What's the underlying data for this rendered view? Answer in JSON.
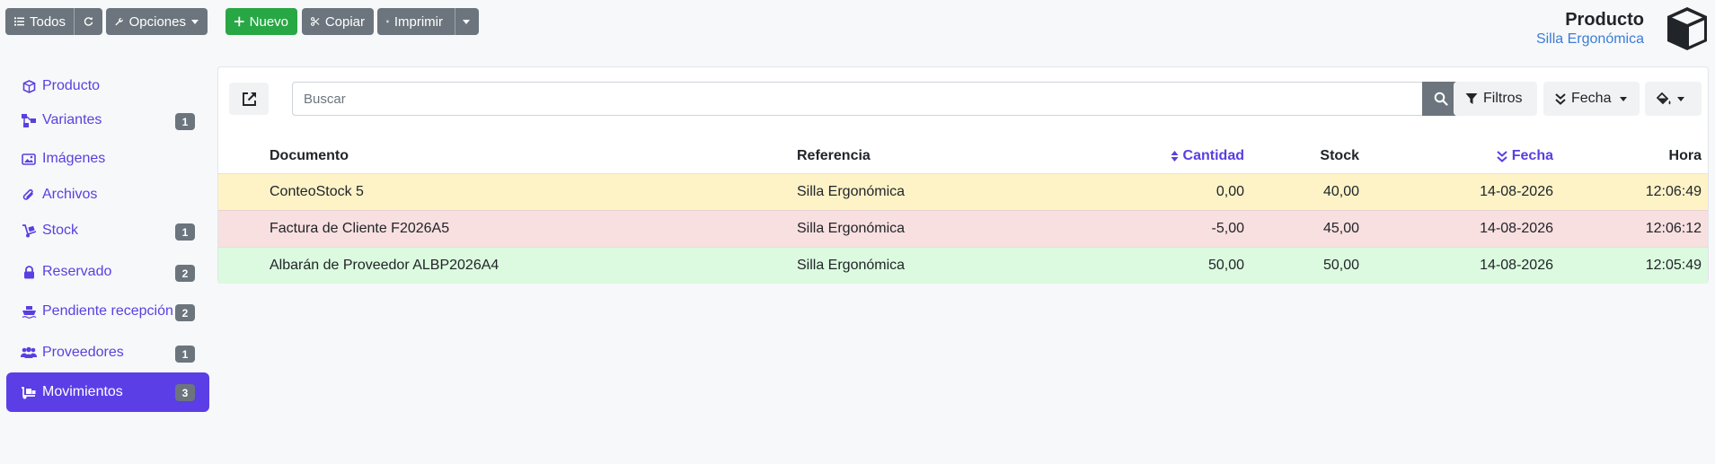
{
  "toolbar": {
    "todos_label": "Todos",
    "opciones_label": "Opciones",
    "nuevo_label": "Nuevo",
    "copiar_label": "Copiar",
    "imprimir_label": "Imprimir"
  },
  "header": {
    "title": "Producto",
    "subtitle": "Silla Ergonómica"
  },
  "sidebar": {
    "items": [
      {
        "label": "Producto",
        "icon": "cube-icon",
        "badge": null
      },
      {
        "label": "Variantes",
        "icon": "sitemap-icon",
        "badge": "1"
      },
      {
        "label": "Imágenes",
        "icon": "images-icon",
        "badge": null
      },
      {
        "label": "Archivos",
        "icon": "paperclip-icon",
        "badge": null
      },
      {
        "label": "Stock",
        "icon": "dolly-icon",
        "badge": "1"
      },
      {
        "label": "Reservado",
        "icon": "lock-icon",
        "badge": "2"
      },
      {
        "label": "Pendiente recepción",
        "icon": "ship-icon",
        "badge": "2"
      },
      {
        "label": "Proveedores",
        "icon": "users-icon",
        "badge": "1"
      },
      {
        "label": "Movimientos",
        "icon": "truck-loading-icon",
        "badge": "3",
        "active": true
      }
    ]
  },
  "list": {
    "search_placeholder": "Buscar",
    "filtros_label": "Filtros",
    "fecha_label": "Fecha",
    "columns": {
      "documento": "Documento",
      "referencia": "Referencia",
      "cantidad": "Cantidad",
      "stock": "Stock",
      "fecha": "Fecha",
      "hora": "Hora"
    },
    "rows": [
      {
        "documento": "ConteoStock 5",
        "referencia": "Silla Ergonómica",
        "cantidad": "0,00",
        "stock": "40,00",
        "fecha": "14-08-2026",
        "hora": "12:06:49",
        "status": "warning"
      },
      {
        "documento": "Factura de Cliente F2026A5",
        "referencia": "Silla Ergonómica",
        "cantidad": "-5,00",
        "stock": "45,00",
        "fecha": "14-08-2026",
        "hora": "12:06:12",
        "status": "danger"
      },
      {
        "documento": "Albarán de Proveedor ALBP2026A4",
        "referencia": "Silla Ergonómica",
        "cantidad": "50,00",
        "stock": "50,00",
        "fecha": "14-08-2026",
        "hora": "12:05:49",
        "status": "success"
      }
    ]
  },
  "colors": {
    "accent": "#5b3ee6",
    "warning_row": "#fdf3c7",
    "danger_row": "#f8dfe0",
    "success_row": "#dcfadf"
  }
}
